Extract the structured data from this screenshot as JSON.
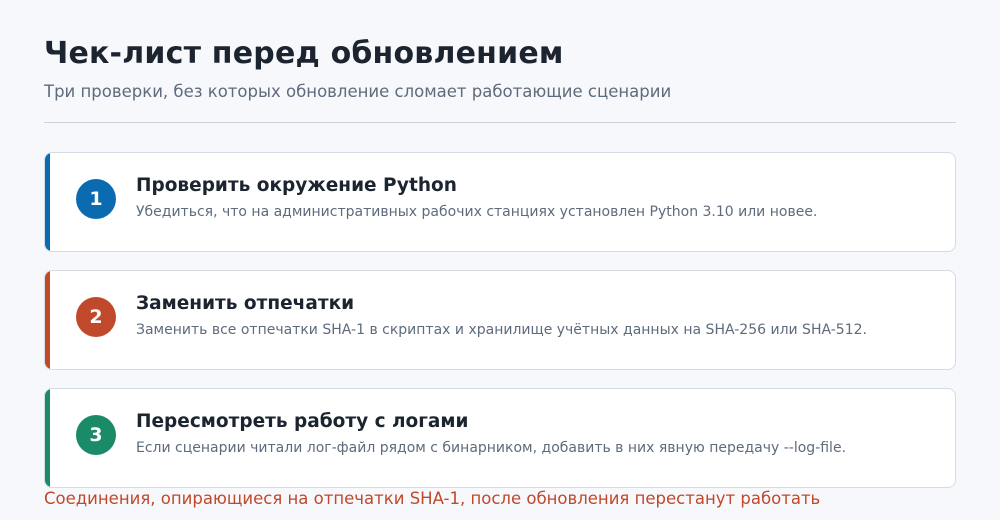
{
  "header": {
    "title": "Чек-лист перед обновлением",
    "subtitle": "Три проверки, без которых обновление сломает работающие сценарии"
  },
  "checklist": {
    "items": [
      {
        "number": "1",
        "title": "Проверить окружение Python",
        "description": "Убедиться, что на административных рабочих станциях установлен Python 3.10 или новее.",
        "color": "#0b6bb0"
      },
      {
        "number": "2",
        "title": "Заменить отпечатки",
        "description": "Заменить все отпечатки SHA-1 в скриптах и хранилище учётных данных на SHA-256 или SHA-512.",
        "color": "#c0492b"
      },
      {
        "number": "3",
        "title": "Пересмотреть работу с логами",
        "description": "Если сценарии читали лог-файл рядом с бинарником, добавить в них явную передачу --log-file.",
        "color": "#1a8a68"
      }
    ]
  },
  "footer": {
    "warning": "Соединения, опирающиеся на отпечатки SHA-1, после обновления перестанут работать"
  }
}
